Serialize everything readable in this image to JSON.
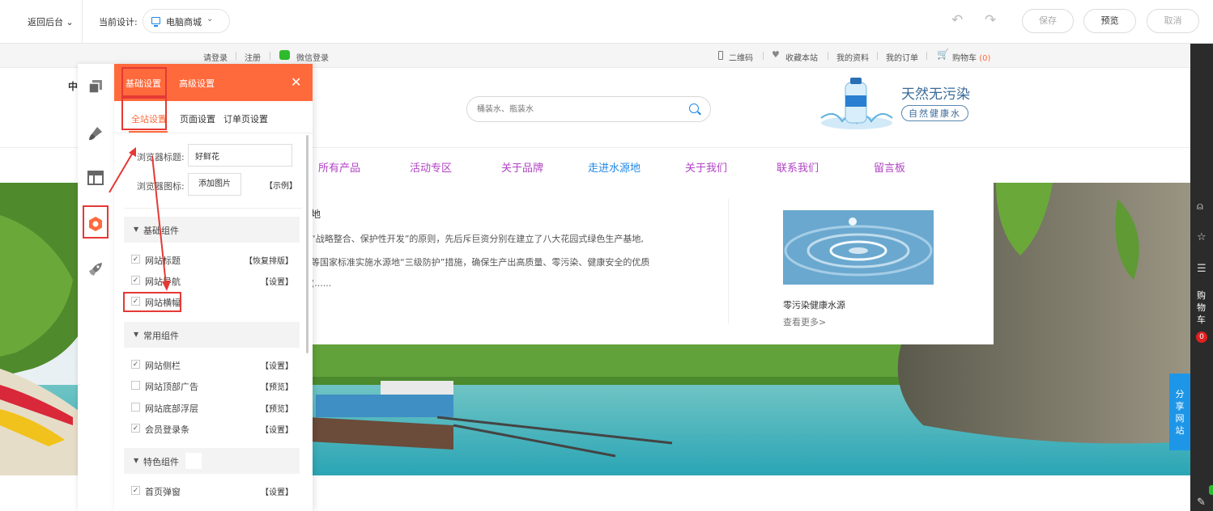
{
  "topbar": {
    "back_label": "返回后台",
    "current_design_label": "当前设计:",
    "design_select": "电脑商城",
    "save": "保存",
    "preview": "预览",
    "cancel": "取消"
  },
  "site_topbar": {
    "login": "请登录",
    "register": "注册",
    "wechat_login": "微信登录",
    "qrcode": "二维码",
    "favorite": "收藏本站",
    "my_profile": "我的资料",
    "my_orders": "我的订单",
    "cart": "购物车",
    "cart_count": "(0)"
  },
  "header": {
    "logo_fragment": "中",
    "search_placeholder": "桶装水、瓶装水",
    "ad_title": "天然无污染",
    "ad_subtitle": "自然健康水"
  },
  "nav": {
    "items": [
      "所有产品",
      "活动专区",
      "关于品牌",
      "走进水源地",
      "关于我们",
      "联系我们",
      "留言板"
    ],
    "active_index": 3
  },
  "content_panel": {
    "title": "地",
    "line1": "“战略整合、保护性开发”的原则，先后斥巨资分别在建立了八大花园式绿色生产基地,",
    "line2": "等国家标准实施水源地“三级防护”措施，确保生产出高质量、零污染、健康安全的优质",
    "line3": "(......",
    "caption": "零污染健康水源",
    "more": "查看更多>"
  },
  "right_rail": {
    "cart_text": [
      "购",
      "物",
      "车"
    ],
    "cart_badge": "0",
    "share": [
      "分",
      "享",
      "网",
      "站"
    ]
  },
  "settings": {
    "tab_basic": "基础设置",
    "tab_advanced": "高级设置",
    "subtab_site": "全站设置",
    "subtab_page": "页面设置",
    "subtab_order": "订单页设置",
    "browser_title_label": "浏览器标题:",
    "browser_title_value": "好鲜花",
    "browser_icon_label": "浏览器图标:",
    "add_image": "添加图片",
    "example": "【示例】",
    "group_basic": "基础组件",
    "group_common": "常用组件",
    "group_special": "特色组件",
    "rows_basic": [
      {
        "label": "网站标题",
        "checked": true,
        "action": "【恢复排版】"
      },
      {
        "label": "网站导航",
        "checked": true,
        "action": "【设置】"
      },
      {
        "label": "网站横幅",
        "checked": true,
        "action": ""
      }
    ],
    "rows_common": [
      {
        "label": "网站侧栏",
        "checked": true,
        "action": "【设置】"
      },
      {
        "label": "网站顶部广告",
        "checked": false,
        "action": "【预览】"
      },
      {
        "label": "网站底部浮层",
        "checked": false,
        "action": "【预览】"
      },
      {
        "label": "会员登录条",
        "checked": true,
        "action": "【设置】"
      }
    ],
    "rows_special": [
      {
        "label": "首页弹窗",
        "checked": true,
        "action": "【设置】"
      }
    ]
  },
  "colors": {
    "accent": "#ff6a3c",
    "link_blue": "#1e88e5",
    "nav_purple": "#b044c4",
    "highlight_red": "#e53935"
  }
}
